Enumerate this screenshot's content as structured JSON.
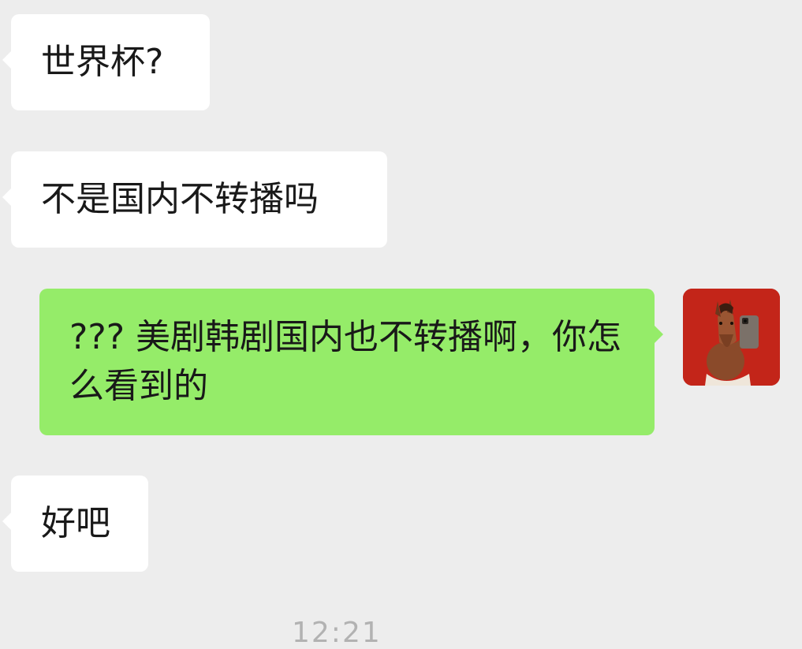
{
  "messages": [
    {
      "side": "left",
      "text": "世界杯?"
    },
    {
      "side": "left",
      "text": "不是国内不转播吗"
    },
    {
      "side": "right",
      "text": "???  美剧韩剧国内也不转播啊，你怎么看到的"
    },
    {
      "side": "left",
      "text": "好吧"
    }
  ],
  "avatar": {
    "icon": "horse-selfie-avatar-icon"
  },
  "timestamp": "12:21",
  "colors": {
    "background": "#ededed",
    "incoming_bubble": "#ffffff",
    "outgoing_bubble": "#95ec69",
    "text": "#191919",
    "timestamp": "#b2b2b2"
  }
}
